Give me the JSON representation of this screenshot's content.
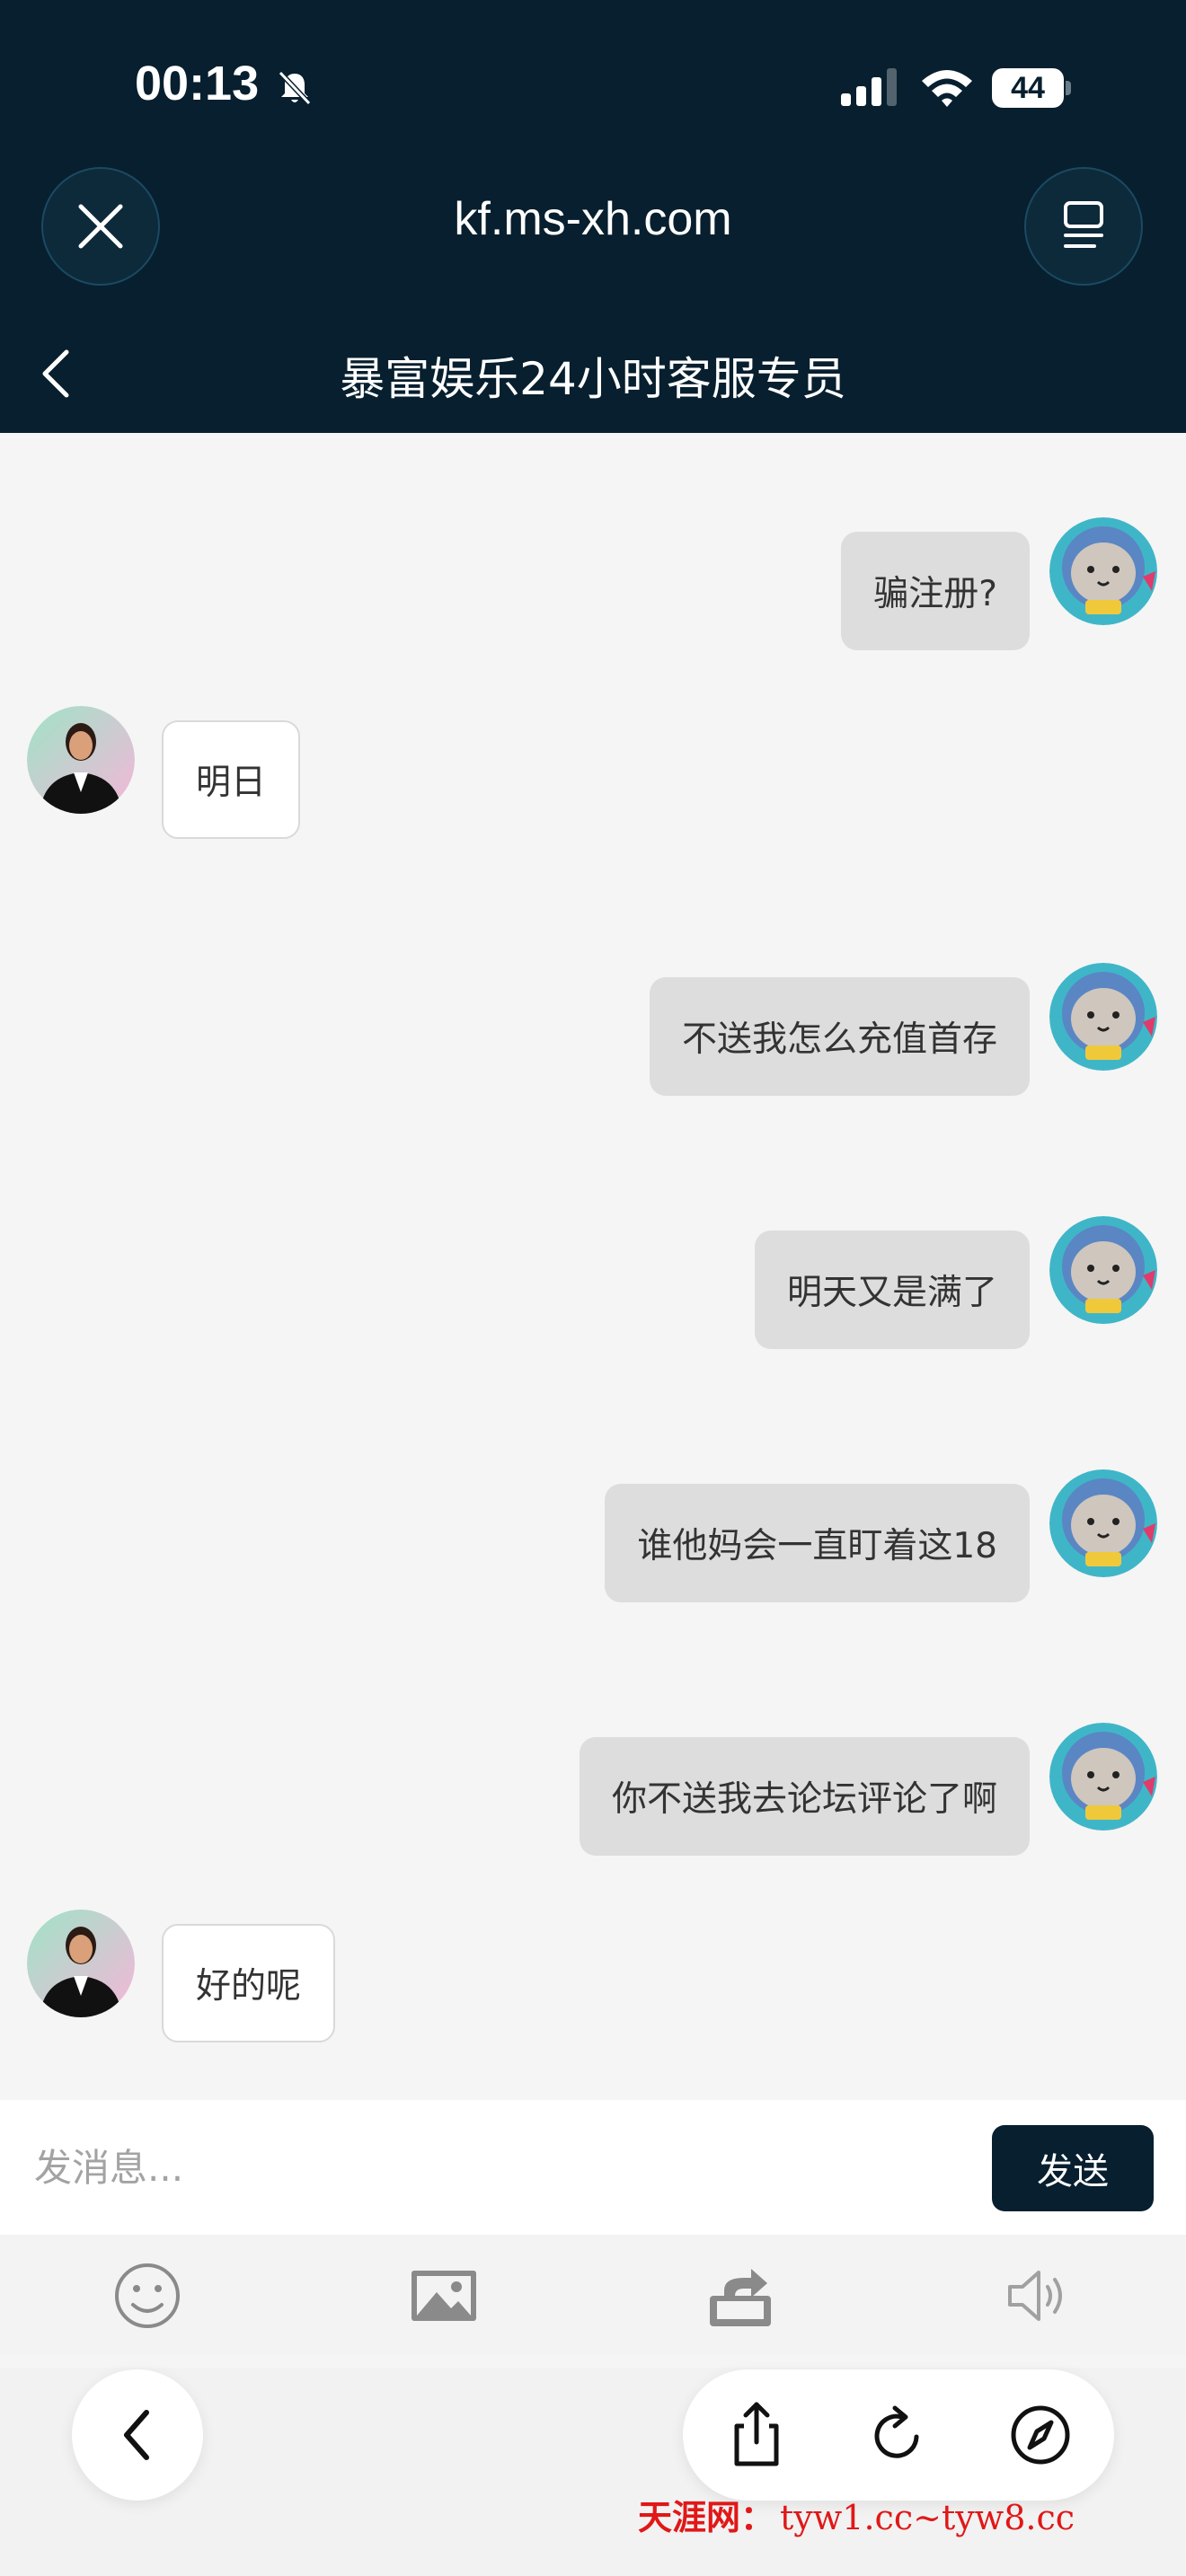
{
  "status_bar": {
    "time": "00:13",
    "battery": "44"
  },
  "browser": {
    "url": "kf.ms-xh.com",
    "close_icon": "close-icon",
    "menu_icon": "menu-icon"
  },
  "chat": {
    "title": "暴富娱乐24小时客服专员",
    "messages": [
      {
        "sender": "user",
        "text": "骗注册?"
      },
      {
        "sender": "agent",
        "text": "明日"
      },
      {
        "sender": "user",
        "text": "不送我怎么充值首存"
      },
      {
        "sender": "user",
        "text": "明天又是满了"
      },
      {
        "sender": "user",
        "text": "谁他妈会一直盯着这18"
      },
      {
        "sender": "user",
        "text": "你不送我去论坛评论了啊"
      },
      {
        "sender": "agent",
        "text": "好的呢"
      }
    ]
  },
  "composer": {
    "placeholder": "发消息...",
    "send_label": "发送"
  },
  "toolbar": {
    "items": [
      "emoji-icon",
      "image-icon",
      "share-icon",
      "speaker-icon"
    ]
  },
  "safari_bar": {
    "items": [
      "back-icon",
      "share-icon",
      "reload-icon",
      "compass-icon"
    ]
  },
  "watermark": {
    "site_name": "天涯网：",
    "domains": "tyw1.cc~tyw8.cc"
  },
  "colors": {
    "header_bg": "#071f2e",
    "send_button": "#071f2e",
    "watermark": "#e01818"
  }
}
